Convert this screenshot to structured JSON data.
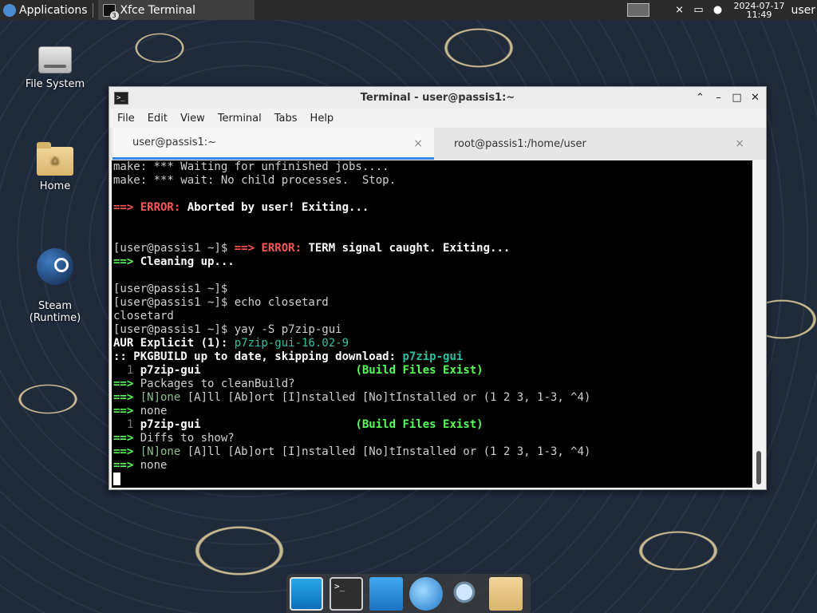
{
  "panel": {
    "applications_label": "Applications",
    "task_label": "Xfce Terminal",
    "task_badge": "3",
    "clock_date": "2024-07-17",
    "clock_time": "11:49",
    "user": "user"
  },
  "desktop": {
    "icons": [
      {
        "label": "File System",
        "icon": "drive-icon"
      },
      {
        "label": "Home",
        "icon": "home-folder-icon"
      },
      {
        "label": "Steam\n(Runtime)",
        "icon": "steam-icon"
      }
    ]
  },
  "window": {
    "title": "Terminal - user@passis1:~",
    "controls": {
      "shade": "⌃",
      "minimize": "–",
      "maximize": "□",
      "close": "✕"
    },
    "menu": [
      "File",
      "Edit",
      "View",
      "Terminal",
      "Tabs",
      "Help"
    ],
    "tabs": [
      {
        "label": "user@passis1:~",
        "active": true
      },
      {
        "label": "root@passis1:/home/user",
        "active": false
      }
    ],
    "tab_close": "×",
    "terminal_lines": [
      [
        {
          "t": "make: *** Waiting for unfinished jobs....",
          "c": ""
        }
      ],
      [
        {
          "t": "make: *** wait: No child processes.  Stop.",
          "c": ""
        }
      ],
      [
        {
          "t": "",
          "c": ""
        }
      ],
      [
        {
          "t": "==> ",
          "c": "red"
        },
        {
          "t": "ERROR: ",
          "c": "red"
        },
        {
          "t": "Aborted by user! Exiting...",
          "c": "b"
        }
      ],
      [
        {
          "t": "",
          "c": ""
        }
      ],
      [
        {
          "t": "",
          "c": ""
        }
      ],
      [
        {
          "t": "[user@passis1 ~]$ ",
          "c": ""
        },
        {
          "t": "==> ",
          "c": "red"
        },
        {
          "t": "ERROR: ",
          "c": "red"
        },
        {
          "t": "TERM signal caught. Exiting...",
          "c": "b"
        }
      ],
      [
        {
          "t": "==> ",
          "c": "green"
        },
        {
          "t": "Cleaning up...",
          "c": "b"
        }
      ],
      [
        {
          "t": "",
          "c": ""
        }
      ],
      [
        {
          "t": "[user@passis1 ~]$",
          "c": ""
        }
      ],
      [
        {
          "t": "[user@passis1 ~]$ echo closetard",
          "c": ""
        }
      ],
      [
        {
          "t": "closetard",
          "c": ""
        }
      ],
      [
        {
          "t": "[user@passis1 ~]$ yay -S p7zip-gui",
          "c": ""
        }
      ],
      [
        {
          "t": "AUR Explicit (1): ",
          "c": "b"
        },
        {
          "t": "p7zip-gui-16.02-9",
          "c": "cyan"
        }
      ],
      [
        {
          "t": ":: PKGBUILD up to date, skipping download: ",
          "c": "b"
        },
        {
          "t": "p7zip-gui",
          "c": "cyanb"
        }
      ],
      [
        {
          "t": "  1 ",
          "c": "gray"
        },
        {
          "t": "p7zip-gui",
          "c": "b"
        },
        {
          "t": "                       ",
          "c": ""
        },
        {
          "t": "(Build Files Exist)",
          "c": "green"
        }
      ],
      [
        {
          "t": "==> ",
          "c": "green"
        },
        {
          "t": "Packages to cleanBuild?",
          "c": ""
        }
      ],
      [
        {
          "t": "==> ",
          "c": "green"
        },
        {
          "t": "[N]one ",
          "c": "dim"
        },
        {
          "t": "[A]ll [Ab]ort [I]nstalled [No]tInstalled or (1 2 3, 1-3, ^4)",
          "c": ""
        }
      ],
      [
        {
          "t": "==> ",
          "c": "green"
        },
        {
          "t": "none",
          "c": ""
        }
      ],
      [
        {
          "t": "  1 ",
          "c": "gray"
        },
        {
          "t": "p7zip-gui",
          "c": "b"
        },
        {
          "t": "                       ",
          "c": ""
        },
        {
          "t": "(Build Files Exist)",
          "c": "green"
        }
      ],
      [
        {
          "t": "==> ",
          "c": "green"
        },
        {
          "t": "Diffs to show?",
          "c": ""
        }
      ],
      [
        {
          "t": "==> ",
          "c": "green"
        },
        {
          "t": "[N]one ",
          "c": "dim"
        },
        {
          "t": "[A]ll [Ab]ort [I]nstalled [No]tInstalled or (1 2 3, 1-3, ^4)",
          "c": ""
        }
      ],
      [
        {
          "t": "==> ",
          "c": "green"
        },
        {
          "t": "none",
          "c": ""
        }
      ]
    ]
  },
  "dock": [
    {
      "name": "show-desktop",
      "icon": "desktop-icon"
    },
    {
      "name": "terminal",
      "icon": "terminal-icon"
    },
    {
      "name": "file-manager",
      "icon": "files-icon"
    },
    {
      "name": "web-browser",
      "icon": "browser-icon"
    },
    {
      "name": "app-finder",
      "icon": "search-icon"
    },
    {
      "name": "home-folder",
      "icon": "folder-icon"
    }
  ]
}
